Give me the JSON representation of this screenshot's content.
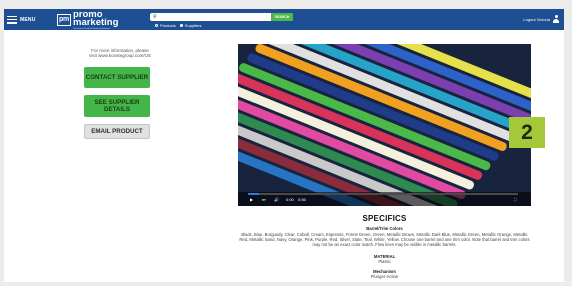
{
  "header": {
    "menu_label": "MENU",
    "logo_mark": "pm",
    "logo_promo": "promo",
    "logo_marketing": "marketing",
    "logo_tagline": "Promotional Products Marketing Solutions",
    "search_placeholder": "",
    "search_button": "SEARCH",
    "radio_products": "Products",
    "radio_suppliers": "Suppliers",
    "user_label": "Logout Victoria"
  },
  "sidebar": {
    "info_line1": "For more information, please",
    "info_line2": "visit www.koostegroup.com/US",
    "contact_button": "CONTACT SUPPLIER",
    "supplier_details_button": "SEE SUPPLIER DETAILS",
    "email_button": "EMAIL PRODUCT"
  },
  "video": {
    "time_current": "0:00",
    "time_total": "0:56",
    "progress": 0.04
  },
  "badge": {
    "label": "2"
  },
  "specifics": {
    "title": "SPECIFICS",
    "colors_label": "Barrel/Trim Colors",
    "colors_text": "Black, Blue, Burgundy, Clear, Cobalt, Cream, Espresso, Forest Green, Green, Metallic Brown, Metallic Dark Blue, Metallic Green, Metallic Orange, Metallic Red, Metallic Sand, Navy, Orange, Pink, Purple, Red, Silver, Slate, Teal, White, Yellow. Choose one barrel and one trim color. Note that barrel and trim colors may not be an exact color match. Flow lines may be visible in metallic barrels.",
    "material_label": "MATERIAL",
    "material_value": "Plastic",
    "mechanism_label": "Mechanism",
    "mechanism_value": "Plunger-Action"
  },
  "colors": {
    "header_bg": "#1e4f93",
    "button_green": "#44b649",
    "badge": "#a5c83a"
  }
}
